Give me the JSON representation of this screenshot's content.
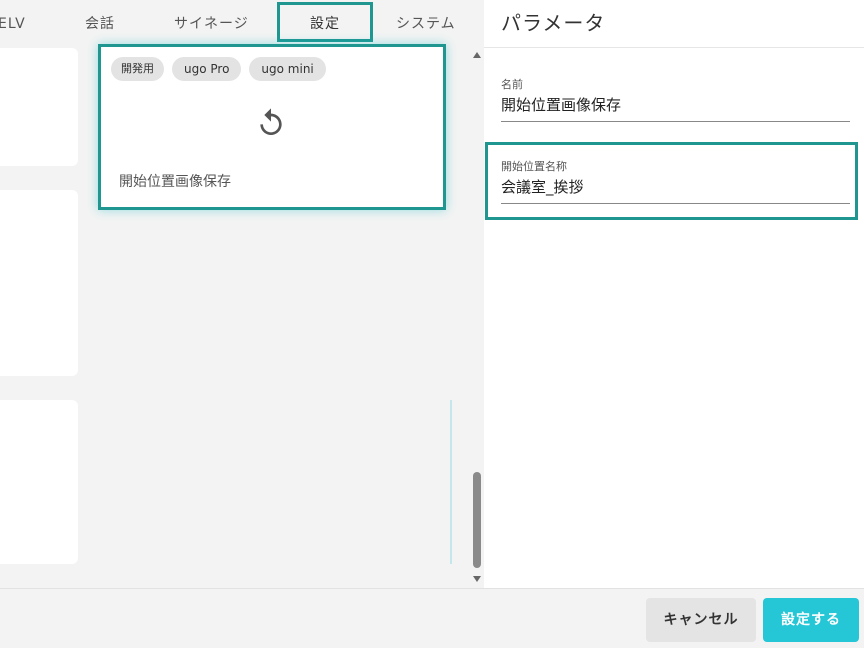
{
  "tabs": [
    {
      "label": "ELV"
    },
    {
      "label": "会話"
    },
    {
      "label": "サイネージ"
    },
    {
      "label": "設定",
      "active": true
    },
    {
      "label": "システム"
    }
  ],
  "card": {
    "chips": [
      "開発用",
      "ugo Pro",
      "ugo mini"
    ],
    "icon": "restore-icon",
    "label": "開始位置画像保存"
  },
  "panel": {
    "title": "パラメータ",
    "fields": [
      {
        "label": "名前",
        "value": "開始位置画像保存"
      },
      {
        "label": "開始位置名称",
        "value": "会議室_挨拶"
      }
    ]
  },
  "footer": {
    "cancel_label": "キャンセル",
    "save_label": "設定する"
  },
  "colors": {
    "accent_teal": "#1f9690",
    "save_button": "#25c6d6"
  }
}
